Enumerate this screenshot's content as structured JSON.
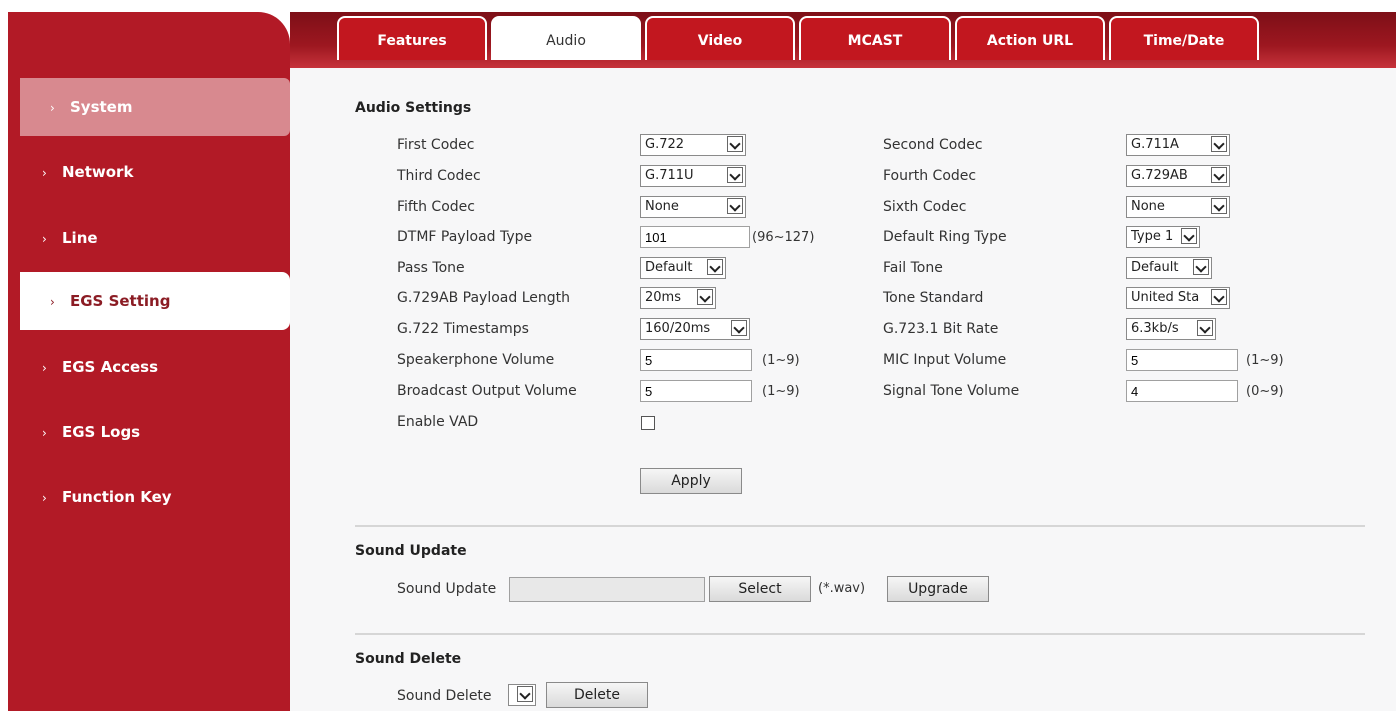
{
  "sidebar": {
    "items": [
      {
        "label": "System",
        "icon": "chevron-right-icon"
      },
      {
        "label": "Network",
        "icon": "chevron-right-icon"
      },
      {
        "label": "Line",
        "icon": "chevron-right-icon"
      },
      {
        "label": "EGS Setting",
        "icon": "chevron-right-icon"
      },
      {
        "label": "EGS Access",
        "icon": "chevron-right-icon"
      },
      {
        "label": "EGS Logs",
        "icon": "chevron-right-icon"
      },
      {
        "label": "Function Key",
        "icon": "chevron-right-icon"
      }
    ],
    "active": "EGS Setting",
    "highlighted": "System"
  },
  "tabs": [
    {
      "label": "Features"
    },
    {
      "label": "Audio"
    },
    {
      "label": "Video"
    },
    {
      "label": "MCAST"
    },
    {
      "label": "Action URL"
    },
    {
      "label": "Time/Date"
    }
  ],
  "active_tab": "Audio",
  "audio": {
    "title": "Audio Settings",
    "first_codec": {
      "label": "First Codec",
      "value": "G.722"
    },
    "second_codec": {
      "label": "Second Codec",
      "value": "G.711A"
    },
    "third_codec": {
      "label": "Third Codec",
      "value": "G.711U"
    },
    "fourth_codec": {
      "label": "Fourth Codec",
      "value": "G.729AB"
    },
    "fifth_codec": {
      "label": "Fifth Codec",
      "value": "None"
    },
    "sixth_codec": {
      "label": "Sixth Codec",
      "value": "None"
    },
    "dtmf": {
      "label": "DTMF Payload Type",
      "value": "101",
      "hint": "(96~127)"
    },
    "ring_type": {
      "label": "Default Ring Type",
      "value": "Type 1"
    },
    "pass_tone": {
      "label": "Pass Tone",
      "value": "Default"
    },
    "fail_tone": {
      "label": "Fail Tone",
      "value": "Default"
    },
    "g729_len": {
      "label": "G.729AB Payload Length",
      "value": "20ms"
    },
    "tone_std": {
      "label": "Tone Standard",
      "value": "United Sta"
    },
    "g722_ts": {
      "label": "G.722 Timestamps",
      "value": "160/20ms"
    },
    "g7231_rate": {
      "label": "G.723.1 Bit Rate",
      "value": "6.3kb/s"
    },
    "spk_vol": {
      "label": "Speakerphone Volume",
      "value": "5",
      "hint": "(1~9)"
    },
    "mic_vol": {
      "label": "MIC Input Volume",
      "value": "5",
      "hint": "(1~9)"
    },
    "bc_vol": {
      "label": "Broadcast Output Volume",
      "value": "5",
      "hint": "(1~9)"
    },
    "sig_vol": {
      "label": "Signal Tone Volume",
      "value": "4",
      "hint": "(0~9)"
    },
    "vad": {
      "label": "Enable VAD",
      "checked": false
    },
    "apply_label": "Apply"
  },
  "sound_update": {
    "title": "Sound Update",
    "label": "Sound Update",
    "value": "",
    "select_label": "Select",
    "hint": "(*.wav)",
    "upgrade_label": "Upgrade"
  },
  "sound_delete": {
    "title": "Sound Delete",
    "label": "Sound Delete",
    "value": "",
    "delete_label": "Delete"
  },
  "colors": {
    "brand": "#b21a26",
    "highlight": "#d8898f",
    "content_bg": "#f7f7f8"
  }
}
